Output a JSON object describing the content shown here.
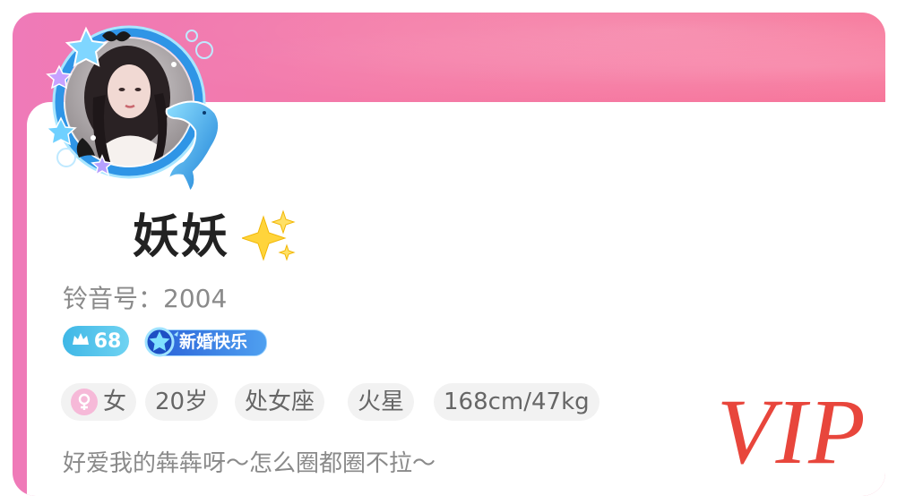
{
  "profile": {
    "nickname": "妖妖",
    "id_label": "铃音号：",
    "id_value": "2004",
    "level_badge": "68",
    "wedding_badge": "新婚快乐",
    "tags": [
      "女",
      "20岁",
      "处女座",
      "火星",
      "168cm/47kg"
    ],
    "signature": "好爱我的犇犇呀～怎么圈都圈不拉～",
    "vip_mark": "VIP"
  },
  "icons": {
    "sparkle": "sparkles-icon",
    "crown": "crown-icon",
    "gender": "female-icon",
    "wedding_star": "star-badge-icon",
    "avatar_frame": "ocean-frame-with-dolphin"
  },
  "colors": {
    "banner_start": "#ef7ab8",
    "banner_end": "#f67196",
    "vip": "#e8463c",
    "level_badge": "#3fb7e6",
    "wedding_badge": "#2a62d8",
    "chip_bg": "#f2f2f2",
    "gender_bg": "#f6b9d8"
  }
}
